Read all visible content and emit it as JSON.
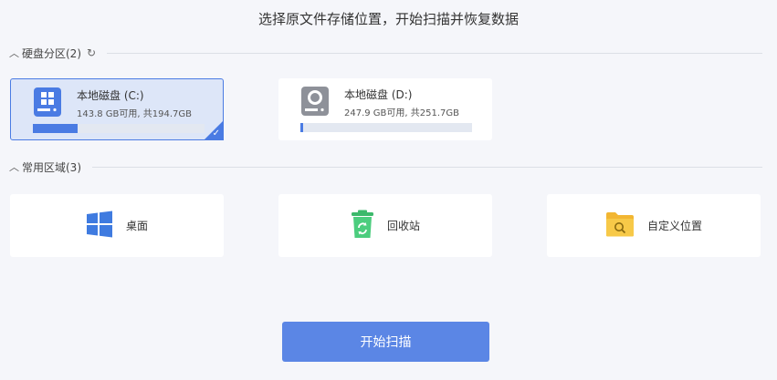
{
  "header": {
    "title": "选择原文件存储位置，开始扫描并恢复数据"
  },
  "disks_section": {
    "label": "硬盘分区(2)",
    "refresh_icon": "refresh-icon"
  },
  "drives": [
    {
      "name": "本地磁盘 (C:)",
      "usage": "143.8 GB可用, 共194.7GB",
      "used_fraction": 0.26,
      "selected": true,
      "icon": "windows-drive-icon"
    },
    {
      "name": "本地磁盘 (D:)",
      "usage": "247.9 GB可用, 共251.7GB",
      "used_fraction": 0.015,
      "selected": false,
      "icon": "hard-drive-icon"
    }
  ],
  "areas_section": {
    "label": "常用区域(3)"
  },
  "areas": [
    {
      "label": "桌面",
      "icon": "windows-desktop-icon"
    },
    {
      "label": "回收站",
      "icon": "recycle-bin-icon"
    },
    {
      "label": "自定义位置",
      "icon": "folder-search-icon"
    }
  ],
  "actions": {
    "scan_label": "开始扫描"
  },
  "colors": {
    "accent": "#4a7be3",
    "button": "#5b86e5",
    "background": "#f5f6fa"
  }
}
